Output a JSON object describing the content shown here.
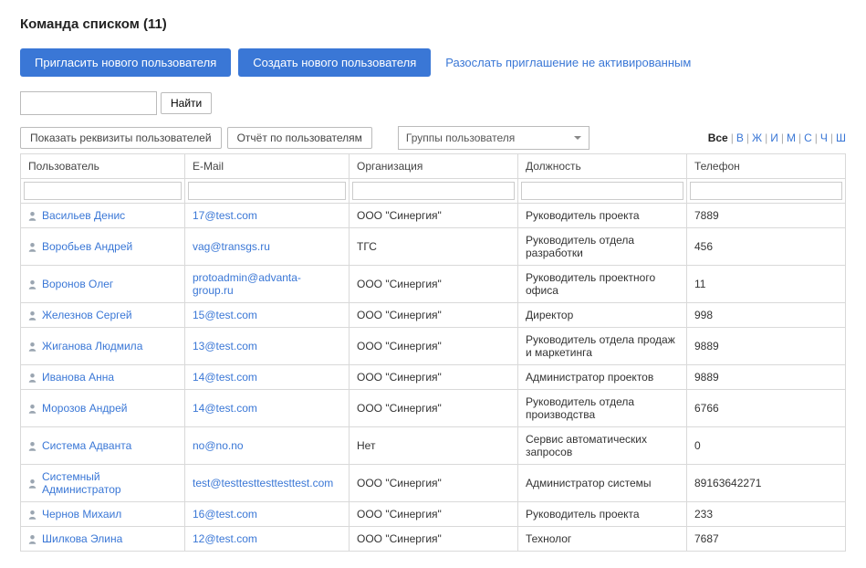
{
  "title": "Команда списком (11)",
  "actions": {
    "invite": "Пригласить нового пользователя",
    "create": "Создать нового пользователя",
    "resend": "Разослать приглашение не активированным"
  },
  "search": {
    "find": "Найти"
  },
  "toolbar": {
    "show_details": "Показать реквизиты пользователей",
    "report": "Отчёт по пользователям",
    "groups": "Группы пользователя"
  },
  "alpha": [
    "Все",
    "В",
    "Ж",
    "И",
    "М",
    "С",
    "Ч",
    "Ш"
  ],
  "columns": {
    "user": "Пользователь",
    "email": "E-Mail",
    "org": "Организация",
    "pos": "Должность",
    "phone": "Телефон"
  },
  "rows": [
    {
      "user": "Васильев Денис",
      "email": "17@test.com",
      "org": "ООО \"Синергия\"",
      "pos": "Руководитель проекта",
      "phone": "7889"
    },
    {
      "user": "Воробьев Андрей",
      "email": "vag@transgs.ru",
      "org": "ТГС",
      "pos": "Руководитель отдела разработки",
      "phone": "456"
    },
    {
      "user": "Воронов Олег",
      "email": "protoadmin@advanta-group.ru",
      "org": "ООО \"Синергия\"",
      "pos": "Руководитель проектного офиса",
      "phone": "11"
    },
    {
      "user": "Железнов Сергей",
      "email": "15@test.com",
      "org": "ООО \"Синергия\"",
      "pos": "Директор",
      "phone": "998"
    },
    {
      "user": "Жиганова Людмила",
      "email": "13@test.com",
      "org": "ООО \"Синергия\"",
      "pos": "Руководитель отдела продаж и маркетинга",
      "phone": "9889"
    },
    {
      "user": "Иванова Анна",
      "email": "14@test.com",
      "org": "ООО \"Синергия\"",
      "pos": "Администратор проектов",
      "phone": "9889"
    },
    {
      "user": "Морозов Андрей",
      "email": "14@test.com",
      "org": "ООО \"Синергия\"",
      "pos": "Руководитель отдела производства",
      "phone": "6766"
    },
    {
      "user": "Система Адванта",
      "email": "no@no.no",
      "org": "Нет",
      "pos": "Сервис автоматических запросов",
      "phone": "0"
    },
    {
      "user": "Системный Администратор",
      "email": "test@testtesttesttesttest.com",
      "org": "ООО \"Синергия\"",
      "pos": "Администратор системы",
      "phone": "89163642271"
    },
    {
      "user": "Чернов Михаил",
      "email": "16@test.com",
      "org": "ООО \"Синергия\"",
      "pos": "Руководитель проекта",
      "phone": "233"
    },
    {
      "user": "Шилкова Элина",
      "email": "12@test.com",
      "org": "ООО \"Синергия\"",
      "pos": "Технолог",
      "phone": "7687"
    }
  ]
}
